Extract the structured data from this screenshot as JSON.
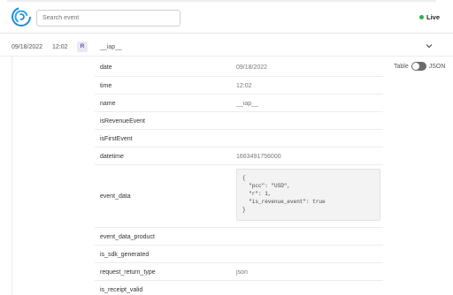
{
  "header": {
    "search_placeholder": "Search event",
    "live_label": "Live",
    "live_color": "#2ab34b",
    "logo_icon": "swirl-logo-icon"
  },
  "event": {
    "date": "09/18/2022",
    "time": "12:02",
    "badge": "R",
    "name": "__iap__"
  },
  "view_toggle": {
    "left_label": "Table",
    "right_label": "JSON"
  },
  "fields": [
    {
      "key": "date",
      "value": "09/18/2022"
    },
    {
      "key": "time",
      "value": "12:02"
    },
    {
      "key": "name",
      "value": "__iap__"
    },
    {
      "key": "isRevenueEvent",
      "value": ""
    },
    {
      "key": "isFirstEvent",
      "value": ""
    },
    {
      "key": "datetime",
      "value": "1663491756000"
    },
    {
      "key": "event_data",
      "value": ""
    },
    {
      "key": "event_data_product",
      "value": ""
    },
    {
      "key": "is_sdk_generated",
      "value": ""
    },
    {
      "key": "request_return_type",
      "value": "json"
    },
    {
      "key": "is_receipt_valid",
      "value": ""
    }
  ],
  "event_data_code": "{\n  \"pcc\": \"USD\",\n  \"r\": 1,\n  \"is_revenue_event\": true\n}"
}
